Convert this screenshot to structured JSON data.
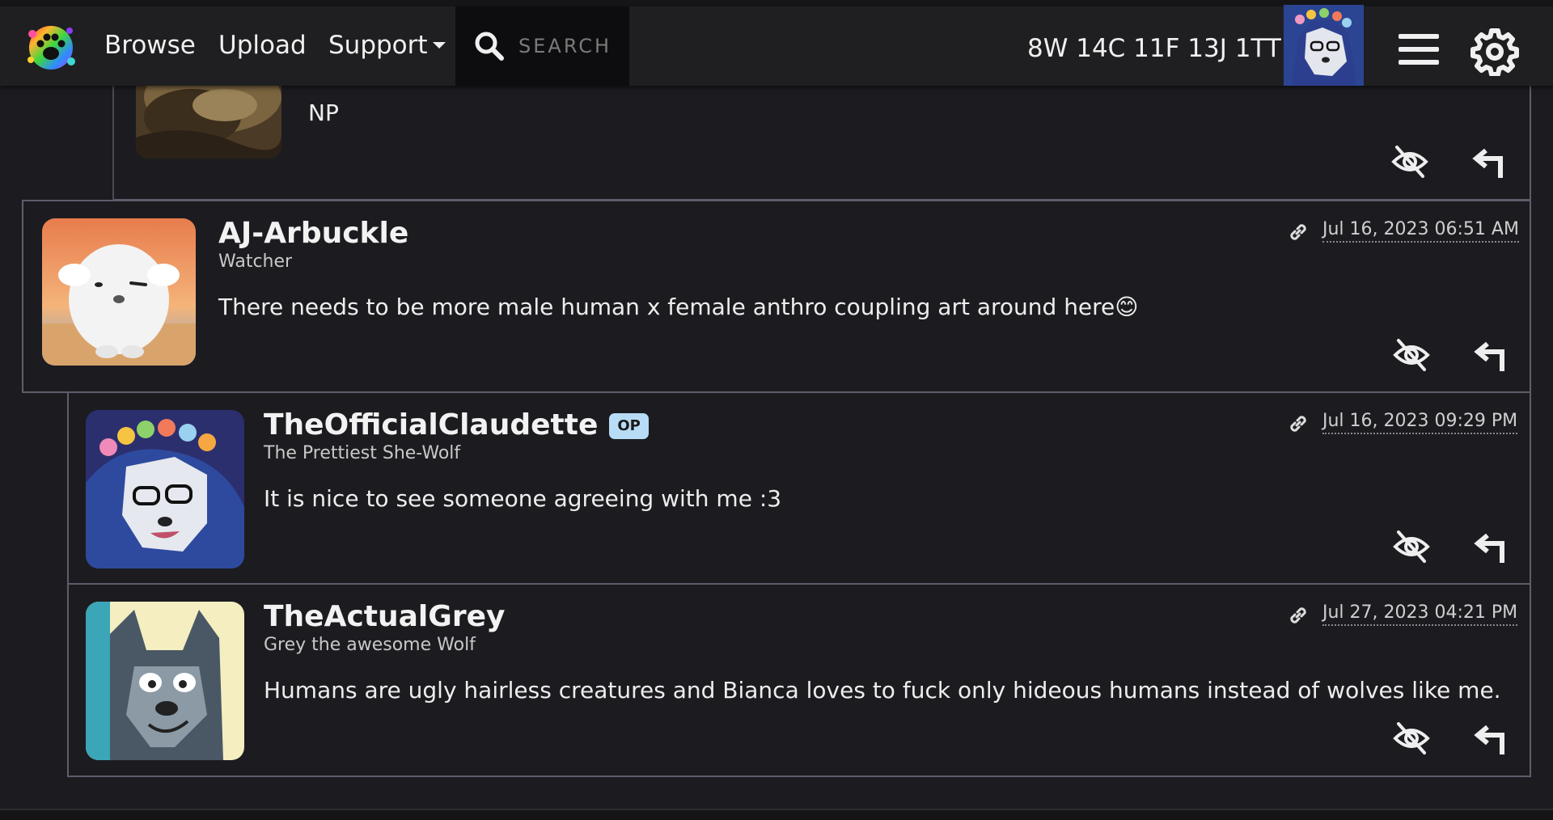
{
  "nav": {
    "browse": "Browse",
    "upload": "Upload",
    "support": "Support",
    "search_placeholder": "SEARCH",
    "notif_counts": "8W 14C 11F 13J 1TT",
    "icons": [
      "paw-logo-icon",
      "search-icon",
      "menu-icon",
      "gear-icon"
    ]
  },
  "comments": [
    {
      "username": "",
      "title": "",
      "body": "NP",
      "timestamp": ""
    },
    {
      "username": "AJ-Arbuckle",
      "title": "Watcher",
      "body": "There needs to be more male human x female anthro coupling art around here😊",
      "timestamp": "Jul 16, 2023 06:51 AM"
    },
    {
      "username": "TheOfficialClaudette",
      "badge": "OP",
      "title": "The Prettiest She-Wolf",
      "body": "It is nice to see someone agreeing with me :3",
      "timestamp": "Jul 16, 2023 09:29 PM"
    },
    {
      "username": "TheActualGrey",
      "title": "Grey the awesome Wolf",
      "body": "Humans are ugly hairless creatures and Bianca loves to fuck only hideous humans instead of wolves like me.",
      "timestamp": "Jul 27, 2023 04:21 PM"
    }
  ],
  "colors": {
    "background": "#1c1c20",
    "nav_background": "#1f1f21",
    "border": "#5d5e6c",
    "op_badge": "#b8dcf5"
  }
}
